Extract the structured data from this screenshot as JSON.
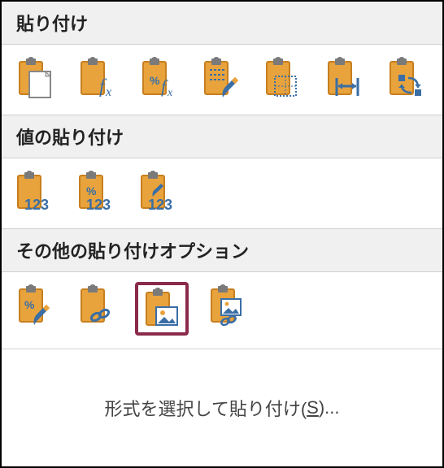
{
  "sections": {
    "paste": {
      "title": "貼り付け"
    },
    "pasteValues": {
      "title": "値の貼り付け"
    },
    "otherOptions": {
      "title": "その他の貼り付けオプション"
    }
  },
  "footer": {
    "prefix": "形式を選択して貼り付け(",
    "accel": "S",
    "suffix": ")..."
  },
  "colors": {
    "clip": "#e8a33d",
    "clipDark": "#c77f1f",
    "overlay": "#3a6ea5",
    "overlayDark": "#2a4f78",
    "gray": "#7a7a7a",
    "highlight": "#8a2a4a"
  }
}
